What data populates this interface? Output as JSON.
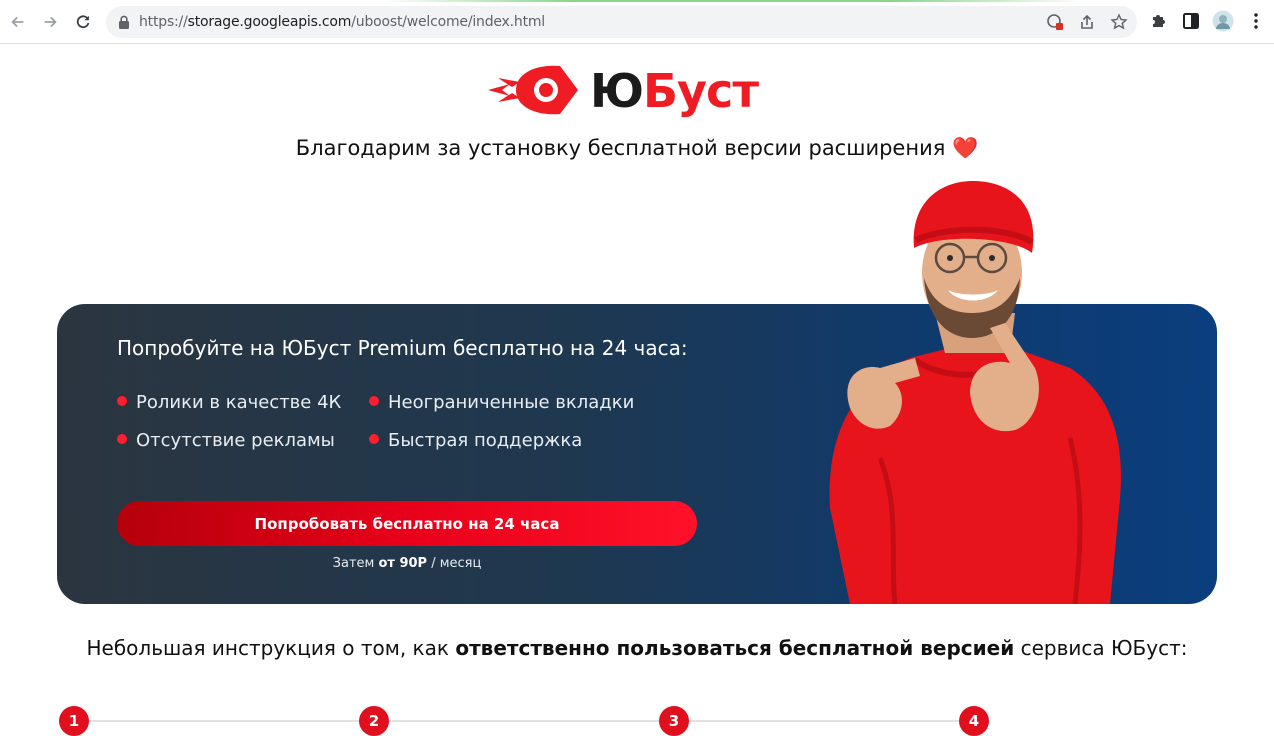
{
  "browser": {
    "url_prefix": "https://",
    "url_host": "storage.googleapis.com",
    "url_path": "/uboost/welcome/index.html"
  },
  "logo": {
    "part1": "Ю",
    "part2": "Буст",
    "colors": {
      "dark": "#1b1b1b",
      "brand": "#ef1c23"
    }
  },
  "thanks": {
    "text": "Благодарим за установку бесплатной версии расширения",
    "emoji": "❤️"
  },
  "banner": {
    "title": "Попробуйте на ЮБуст Premium бесплатно на 24 часа:",
    "features": [
      "Ролики в качестве 4К",
      "Неограниченные вкладки",
      "Отсутствие рекламы",
      "Быстрая поддержка"
    ],
    "cta_label": "Попробовать бесплатно на 24 часа",
    "then_prefix": "Затем ",
    "then_price": "от 90Р",
    "then_suffix": " / месяц"
  },
  "instruction": {
    "prefix": "Небольшая инструкция о том, как ",
    "bold": "ответственно пользоваться бесплатной версией",
    "suffix": " сервиса ЮБуст:"
  },
  "steps": [
    "1",
    "2",
    "3",
    "4"
  ],
  "colors": {
    "accent": "#e0101f",
    "banner_dark": "#2b3540",
    "banner_blue": "#0b3e7e"
  }
}
